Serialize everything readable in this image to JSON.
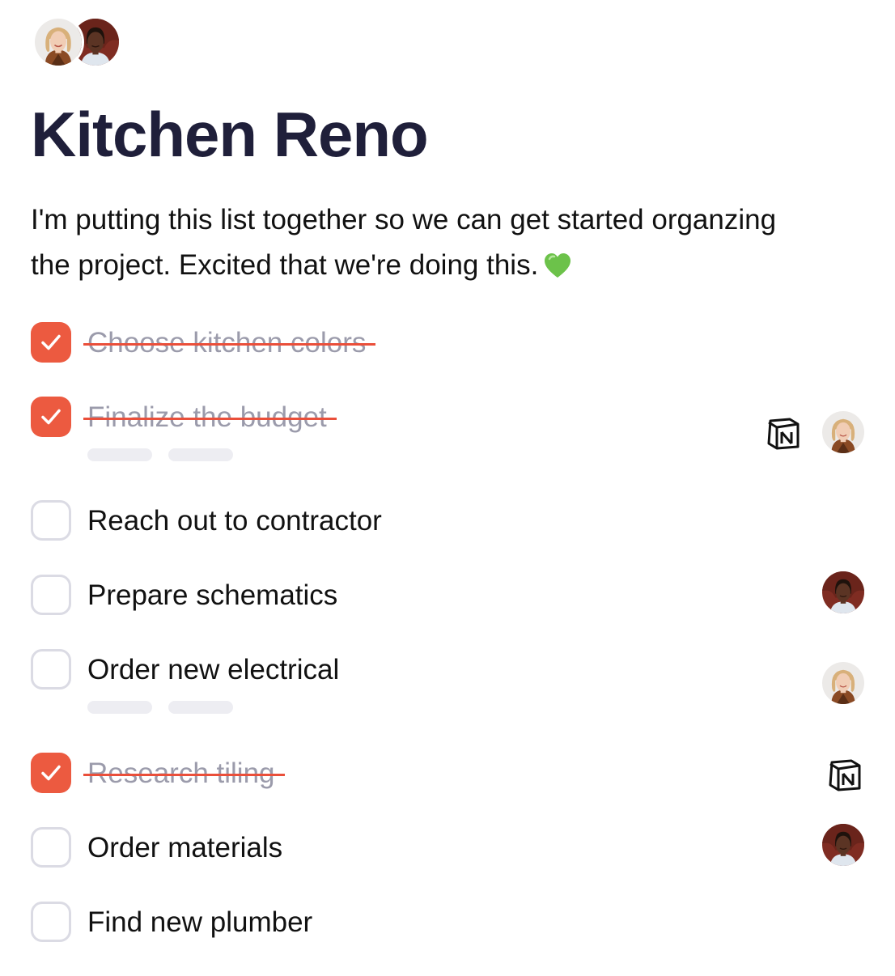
{
  "page": {
    "title": "Kitchen Reno",
    "intro": "I'm putting this list together so we can get started organzing the project. Excited that we're doing this.",
    "intro_emoji": "green-heart-icon"
  },
  "collaborators": [
    {
      "name": "woman-blonde-avatar"
    },
    {
      "name": "woman-dark-hair-avatar"
    }
  ],
  "colors": {
    "accent": "#ec5a40",
    "title": "#1f1f3a",
    "done_text": "#9b9bab",
    "unchecked_border": "#dbdbe4",
    "placeholder": "#ededf2"
  },
  "tasks": [
    {
      "label": "Choose kitchen colors",
      "done": true,
      "placeholders": false,
      "badges": []
    },
    {
      "label": "Finalize the budget",
      "done": true,
      "placeholders": true,
      "badges": [
        "notion-icon",
        "woman-blonde-avatar"
      ]
    },
    {
      "label": "Reach out to contractor",
      "done": false,
      "placeholders": false,
      "badges": []
    },
    {
      "label": "Prepare schematics",
      "done": false,
      "placeholders": false,
      "badges": [
        "woman-dark-hair-avatar"
      ]
    },
    {
      "label": "Order new electrical",
      "done": false,
      "placeholders": true,
      "badges": [
        "woman-blonde-avatar"
      ]
    },
    {
      "label": "Research tiling",
      "done": true,
      "placeholders": false,
      "badges": [
        "notion-icon"
      ]
    },
    {
      "label": "Order materials",
      "done": false,
      "placeholders": false,
      "badges": [
        "woman-dark-hair-avatar"
      ]
    },
    {
      "label": "Find new plumber",
      "done": false,
      "placeholders": false,
      "badges": []
    }
  ]
}
